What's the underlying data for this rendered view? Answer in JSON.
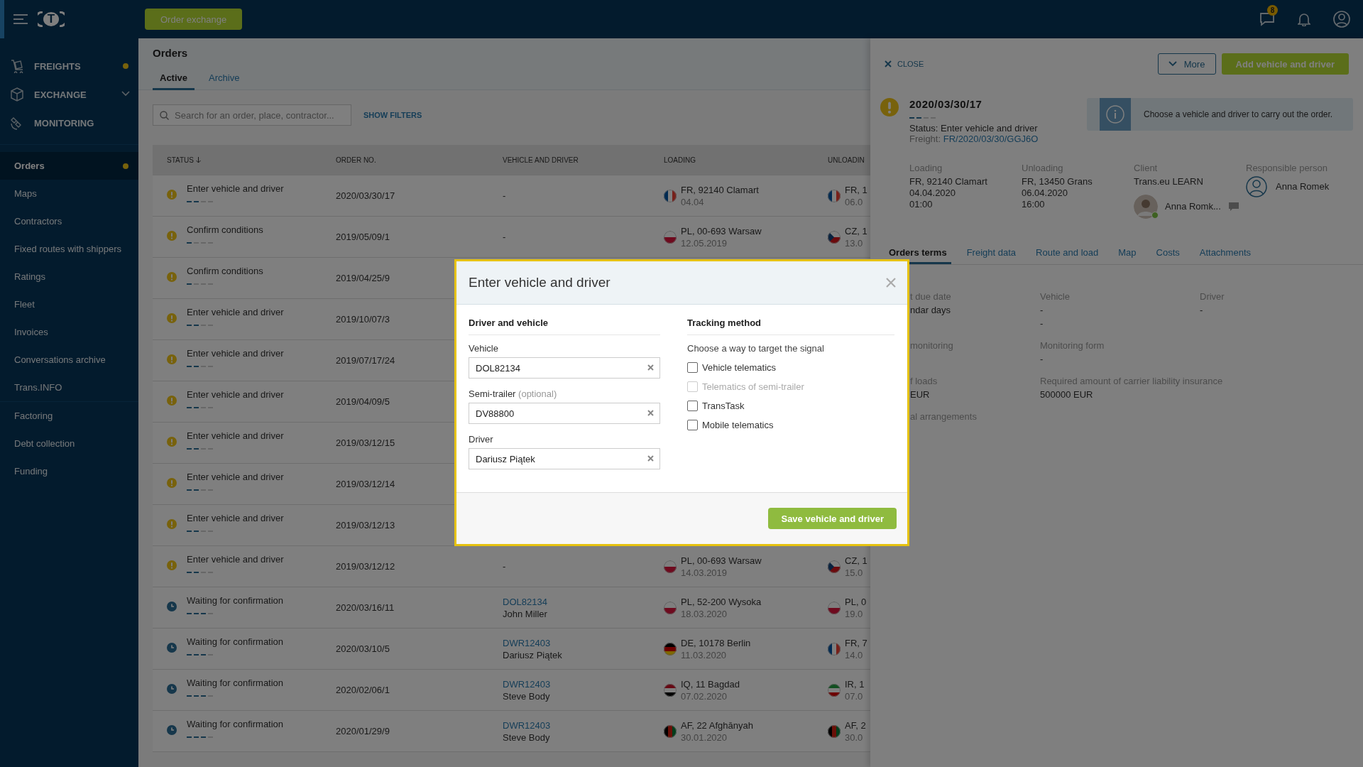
{
  "topbar": {
    "logo": "T",
    "button": "Order exchange",
    "messages_badge": "8"
  },
  "sidebar": {
    "main_items": [
      {
        "label": "FREIGHTS",
        "kind": "freights",
        "dot": true,
        "chevron": false
      },
      {
        "label": "EXCHANGE",
        "kind": "exchange",
        "dot": false,
        "chevron": true
      },
      {
        "label": "MONITORING",
        "kind": "monitoring",
        "dot": false,
        "chevron": false
      }
    ],
    "items": [
      {
        "label": "Orders",
        "selected": true,
        "dot": true
      },
      {
        "label": "Maps",
        "selected": false,
        "dot": false
      },
      {
        "label": "Contractors",
        "selected": false,
        "dot": false
      },
      {
        "label": "Fixed routes with shippers",
        "selected": false,
        "dot": false
      },
      {
        "label": "Ratings",
        "selected": false,
        "dot": false
      },
      {
        "label": "Fleet",
        "selected": false,
        "dot": false
      },
      {
        "label": "Invoices",
        "selected": false,
        "dot": false
      },
      {
        "label": "Conversations archive",
        "selected": false,
        "dot": false
      },
      {
        "label": "Trans.INFO",
        "selected": false,
        "dot": false
      }
    ],
    "extra_items": [
      {
        "label": "Factoring",
        "selected": false,
        "dot": false
      },
      {
        "label": "Debt collection",
        "selected": false,
        "dot": false
      },
      {
        "label": "Funding",
        "selected": false,
        "dot": false
      }
    ]
  },
  "orders": {
    "title": "Orders",
    "tabs": [
      {
        "label": "Active",
        "selected": true
      },
      {
        "label": "Archive",
        "selected": false
      }
    ],
    "search": {
      "placeholder": "Search for an order, place, contractor..."
    },
    "filters_link": "SHOW FILTERS",
    "table": {
      "columns": [
        {
          "label": "STATUS",
          "sorted": true
        },
        {
          "label": "ORDER NO."
        },
        {
          "label": "VEHICLE AND DRIVER"
        },
        {
          "label": "LOADING"
        },
        {
          "label": "UNLOADIN"
        }
      ],
      "rows": [
        {
          "kind": "warning",
          "status": "Enter vehicle and driver",
          "level": 0.5,
          "order_no": "2020/03/30/17",
          "vehicle": "-",
          "loading": {
            "kind": "fr",
            "place": "FR, 92140 Clamart",
            "date": "04.04"
          },
          "unloading": {
            "kind": "fr",
            "place": "FR, 1",
            "date": "06.0"
          }
        },
        {
          "kind": "warning",
          "status": "Confirm conditions",
          "level": 0.25,
          "order_no": "2019/05/09/1",
          "vehicle": "-",
          "loading": {
            "kind": "pl",
            "place": "PL, 00-693 Warsaw",
            "date": "12.05.2019"
          },
          "unloading": {
            "kind": "cz",
            "place": "CZ, 1",
            "date": "13.0"
          }
        },
        {
          "kind": "warning",
          "status": "Confirm conditions",
          "level": 0.25,
          "order_no": "2019/04/25/9"
        },
        {
          "kind": "warning",
          "status": "Enter vehicle and driver",
          "level": 0.5,
          "order_no": "2019/10/07/3"
        },
        {
          "kind": "warning",
          "status": "Enter vehicle and driver",
          "level": 0.5,
          "order_no": "2019/07/17/24"
        },
        {
          "kind": "warning",
          "status": "Enter vehicle and driver",
          "level": 0.5,
          "order_no": "2019/04/09/5"
        },
        {
          "kind": "warning",
          "status": "Enter vehicle and driver",
          "level": 0.5,
          "order_no": "2019/03/12/15"
        },
        {
          "kind": "warning",
          "status": "Enter vehicle and driver",
          "level": 0.5,
          "order_no": "2019/03/12/14"
        },
        {
          "kind": "warning",
          "status": "Enter vehicle and driver",
          "level": 0.5,
          "order_no": "2019/03/12/13"
        },
        {
          "kind": "warning",
          "status": "Enter vehicle and driver",
          "level": 0.5,
          "order_no": "2019/03/12/12",
          "vehicle": "-",
          "loading": {
            "kind": "pl",
            "place": "PL, 00-693 Warsaw",
            "date": "14.03.2019"
          },
          "unloading": {
            "kind": "cz",
            "place": "CZ, 1",
            "date": "15.0"
          }
        },
        {
          "kind": "clock",
          "status": "Waiting for confirmation",
          "level": 0.75,
          "order_no": "2020/03/16/11",
          "vehicle": {
            "plate": "DOL82134",
            "driver": "John Miller"
          },
          "loading": {
            "kind": "pl",
            "place": "PL, 52-200 Wysoka",
            "date": "18.03.2020"
          },
          "unloading": {
            "kind": "pl",
            "place": "PL, 0",
            "date": "19.0"
          }
        },
        {
          "kind": "clock",
          "status": "Waiting for confirmation",
          "level": 0.75,
          "order_no": "2020/03/10/5",
          "vehicle": {
            "plate": "DWR12403",
            "driver": "Dariusz Piątek"
          },
          "loading": {
            "kind": "de",
            "place": "DE, 10178 Berlin",
            "date": "11.03.2020"
          },
          "unloading": {
            "kind": "fr",
            "place": "FR, 7",
            "date": "14.0"
          }
        },
        {
          "kind": "clock",
          "status": "Waiting for confirmation",
          "level": 0.75,
          "order_no": "2020/02/06/1",
          "vehicle": {
            "plate": "DWR12403",
            "driver": "Steve Body"
          },
          "loading": {
            "kind": "iq",
            "place": "IQ, 11 Bagdad",
            "date": "07.02.2020"
          },
          "unloading": {
            "kind": "ir",
            "place": "IR, 1",
            "date": "07.0"
          }
        },
        {
          "kind": "clock",
          "status": "Waiting for confirmation",
          "level": 0.75,
          "order_no": "2020/01/29/9",
          "vehicle": {
            "plate": "DWR12403",
            "driver": "Steve Body"
          },
          "loading": {
            "kind": "af",
            "place": "AF, 22 Afghānyah",
            "date": "30.01.2020"
          },
          "unloading": {
            "kind": "af",
            "place": "AF, 2",
            "date": "30.0"
          }
        }
      ]
    }
  },
  "order_panel": {
    "close": "CLOSE",
    "more": "More",
    "primary": "Add vehicle and driver",
    "order_no": "2020/03/30/17",
    "level": 0.5,
    "status": "Status: Enter vehicle and driver",
    "freight_label": "Freight:",
    "freight_link": "FR/2020/03/30/GGJ6O",
    "info": "Choose a vehicle and driver to carry out the order.",
    "details": [
      {
        "label": "Loading",
        "lines": [
          "FR, 92140 Clamart",
          "04.04.2020",
          "01:00"
        ]
      },
      {
        "label": "Unloading",
        "lines": [
          "FR, 13450 Grans",
          "06.04.2020",
          "16:00"
        ]
      },
      {
        "label": "Client",
        "lines": [
          "Trans.eu LEARN"
        ],
        "contact": {
          "name": "Anna Romk...",
          "online": true
        }
      },
      {
        "label": "Responsible person",
        "person": "Anna Romek"
      }
    ],
    "tabs": [
      {
        "label": "Orders terms",
        "selected": true
      },
      {
        "label": "Freight data",
        "selected": false
      },
      {
        "label": "Route and load",
        "selected": false
      },
      {
        "label": "Map",
        "selected": false
      },
      {
        "label": "Costs",
        "selected": false
      },
      {
        "label": "Attachments",
        "selected": false
      }
    ],
    "terms": [
      [
        {
          "label": "t due date",
          "values": [
            "ndar days"
          ]
        },
        {
          "label": "Vehicle",
          "values": [
            "-",
            "-"
          ]
        },
        {
          "label": "Driver",
          "values": [
            "-"
          ]
        }
      ],
      [
        {
          "label": "monitoring"
        },
        {
          "label": "Monitoring form",
          "values": [
            "-"
          ]
        }
      ],
      [
        {
          "label": "f loads",
          "values": [
            "EUR"
          ]
        },
        {
          "label": "Required amount of carrier liability insurance",
          "values": [
            "500000 EUR"
          ]
        }
      ],
      [
        {
          "label": "al arrangements"
        }
      ]
    ]
  },
  "modal": {
    "title": "Enter vehicle and driver",
    "left_heading": "Driver and vehicle",
    "fields": [
      {
        "label": "Vehicle",
        "value": "DOL82134"
      },
      {
        "label": "Semi-trailer",
        "hint": "(optional)",
        "value": "DV88800"
      },
      {
        "label": "Driver",
        "value": "Dariusz Piątek"
      }
    ],
    "right_heading": "Tracking method",
    "prompt": "Choose a way to target the signal",
    "options": [
      {
        "label": "Vehicle telematics",
        "checked": false,
        "disabled": false
      },
      {
        "label": "Telematics of semi-trailer",
        "checked": false,
        "disabled": true
      },
      {
        "label": "TransTask",
        "checked": false,
        "disabled": false
      },
      {
        "label": "Mobile telematics",
        "checked": false,
        "disabled": false
      }
    ],
    "save": "Save vehicle and driver"
  }
}
